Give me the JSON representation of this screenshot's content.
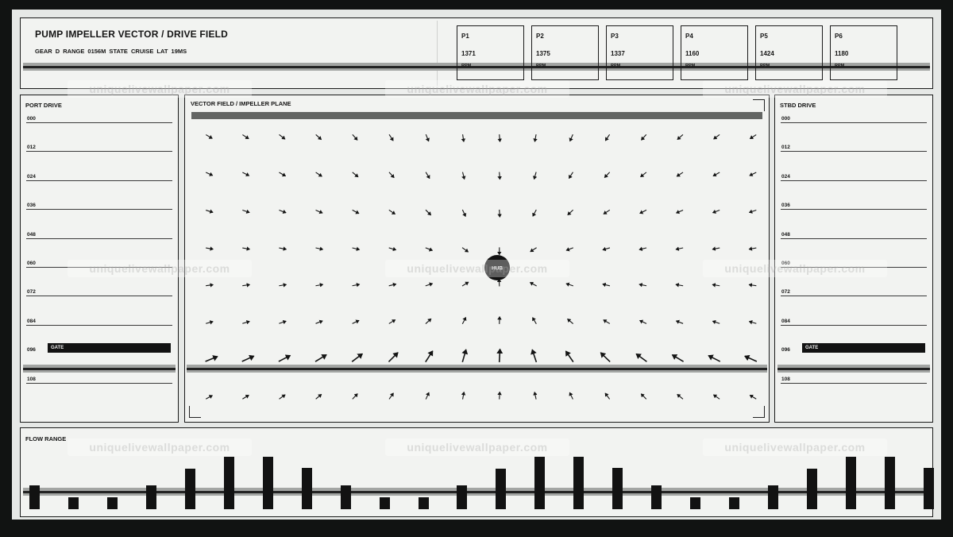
{
  "header": {
    "title": "PUMP IMPELLER VECTOR  /  DRIVE FIELD",
    "meta": "GEAR D   RANGE 0156M   STATE CRUISE   LAT 19MS"
  },
  "pumps": [
    {
      "label": "P1",
      "value": "1371",
      "unit": "RPM"
    },
    {
      "label": "P2",
      "value": "1375",
      "unit": "RPM"
    },
    {
      "label": "P3",
      "value": "1337",
      "unit": "RPM"
    },
    {
      "label": "P4",
      "value": "1160",
      "unit": "RPM"
    },
    {
      "label": "P5",
      "value": "1424",
      "unit": "RPM"
    },
    {
      "label": "P6",
      "value": "1180",
      "unit": "RPM"
    }
  ],
  "port": {
    "title": "PORT DRIVE",
    "ticks": [
      "000",
      "012",
      "024",
      "036",
      "048",
      "060",
      "072",
      "084",
      "096",
      "108"
    ],
    "gate_label": "GATE"
  },
  "stbd": {
    "title": "STBD DRIVE",
    "ticks": [
      "000",
      "012",
      "024",
      "036",
      "048",
      "060",
      "072",
      "084",
      "096",
      "108"
    ],
    "gate_label": "GATE"
  },
  "field": {
    "title": "VECTOR FIELD  /  IMPELLER PLANE",
    "hub_label": "HUB",
    "cols": 16,
    "rows": 8
  },
  "flow": {
    "title": "FLOW RANGE",
    "values": [
      0.45,
      0.22,
      0.22,
      0.45,
      0.77,
      1.0,
      1.0,
      0.79,
      0.46,
      0.22,
      0.22,
      0.45,
      0.77,
      1.0,
      1.0,
      0.79,
      0.46,
      0.22,
      0.22,
      0.45,
      0.77,
      1.0,
      1.0,
      0.79
    ]
  },
  "watermark": "uniquelivewallpaper.com",
  "colors": {
    "frame": "#111312",
    "panel": "#f2f3f1",
    "ink": "#141414",
    "rail": "#a3a5a3"
  }
}
